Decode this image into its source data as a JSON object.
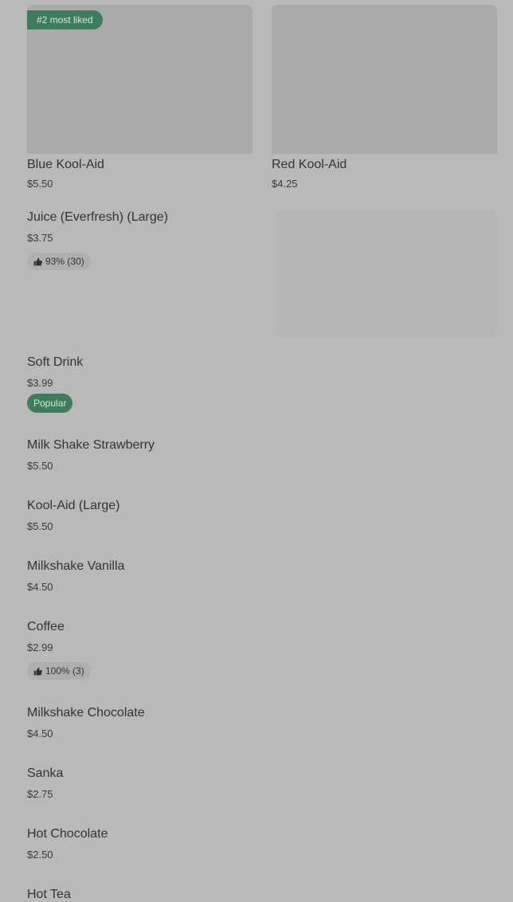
{
  "featured": [
    {
      "name": "Blue Kool-Aid",
      "price": "$5.50",
      "badge": "#2 most liked"
    },
    {
      "name": "Red Kool-Aid",
      "price": "$4.25"
    }
  ],
  "items": [
    {
      "name": "Juice (Everfresh) (Large)",
      "price": "$3.75",
      "rating": "93% (30)",
      "icon": "thumbs-up-icon",
      "has_image": true
    },
    {
      "name": "Soft Drink",
      "price": "$3.99",
      "tag": "Popular"
    },
    {
      "name": "Milk Shake Strawberry",
      "price": "$5.50"
    },
    {
      "name": "Kool-Aid (Large)",
      "price": "$5.50"
    },
    {
      "name": "Milkshake Vanilla",
      "price": "$4.50"
    },
    {
      "name": "Coffee",
      "price": "$2.99",
      "rating": "100% (3)",
      "icon": "thumbs-up-icon"
    },
    {
      "name": "Milkshake Chocolate",
      "price": "$4.50"
    },
    {
      "name": "Sanka",
      "price": "$2.75"
    },
    {
      "name": "Hot Chocolate",
      "price": "$2.50"
    },
    {
      "name": "Hot Tea",
      "price": ""
    }
  ],
  "colors": {
    "badge_green": "#3e7d5c",
    "overlay_gray": "#b9b9b9"
  }
}
